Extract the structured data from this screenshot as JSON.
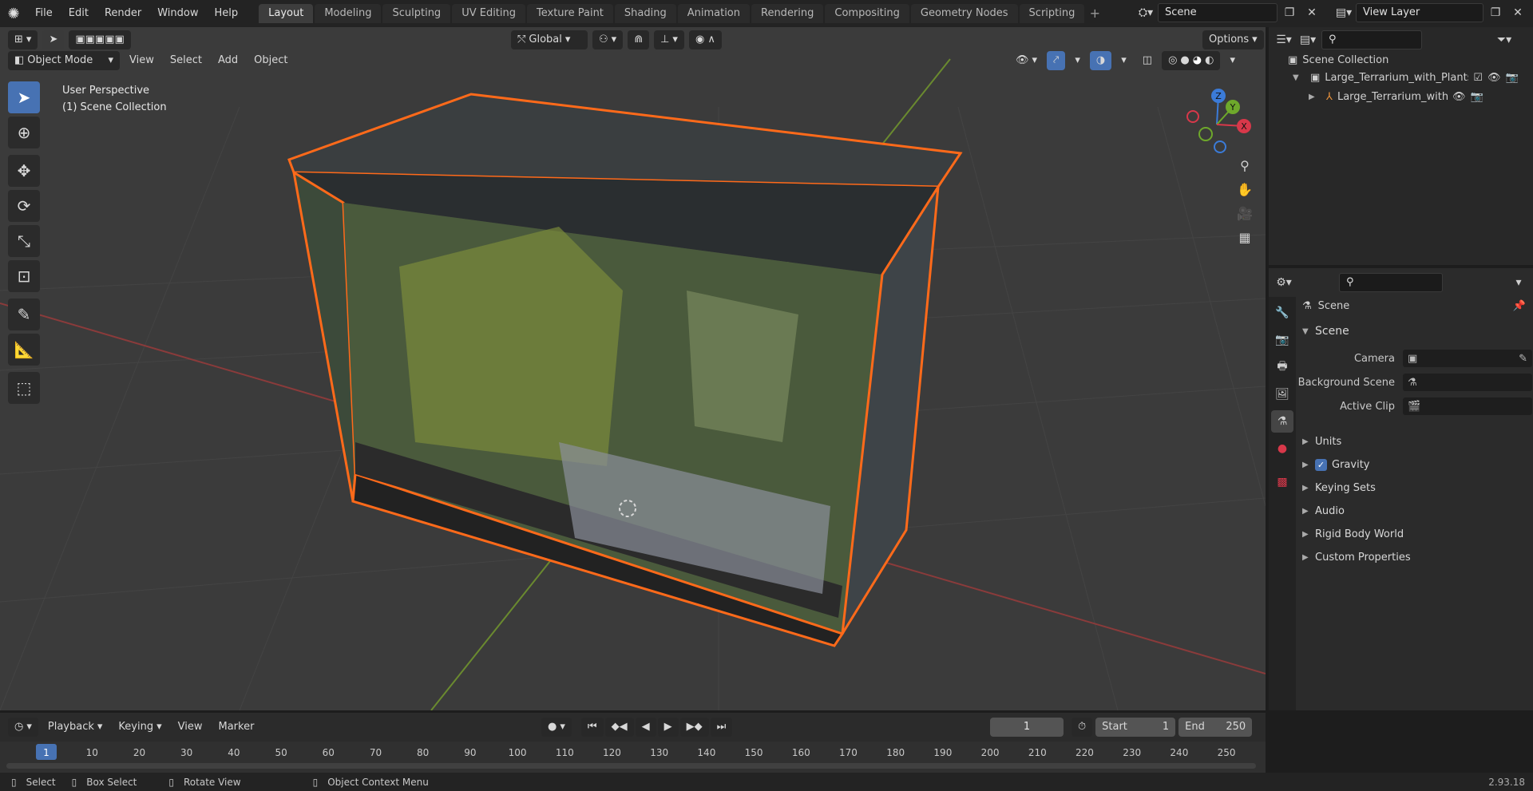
{
  "topbar": {
    "menus": [
      "File",
      "Edit",
      "Render",
      "Window",
      "Help"
    ],
    "workspaces": [
      "Layout",
      "Modeling",
      "Sculpting",
      "UV Editing",
      "Texture Paint",
      "Shading",
      "Animation",
      "Rendering",
      "Compositing",
      "Geometry Nodes",
      "Scripting"
    ],
    "active_workspace": "Layout",
    "scene_name": "Scene",
    "view_layer": "View Layer"
  },
  "viewport": {
    "mode": "Object Mode",
    "menus": [
      "View",
      "Select",
      "Add",
      "Object"
    ],
    "transform_orientation": "Global",
    "options_label": "Options",
    "overlay_title": "User Perspective",
    "overlay_sub": "(1) Scene Collection",
    "gizmo": {
      "x": "X",
      "y": "Y",
      "z": "Z"
    }
  },
  "outliner": {
    "root": "Scene Collection",
    "items": [
      {
        "label": "Large_Terrarium_with_Plants_"
      },
      {
        "label": "Large_Terrarium_with_Pl"
      }
    ]
  },
  "properties": {
    "header": "Scene",
    "panel": "Scene",
    "fields": [
      {
        "label": "Camera",
        "value": ""
      },
      {
        "label": "Background Scene",
        "value": ""
      },
      {
        "label": "Active Clip",
        "value": ""
      }
    ],
    "sections": [
      "Units",
      "Gravity",
      "Keying Sets",
      "Audio",
      "Rigid Body World",
      "Custom Properties"
    ],
    "gravity_checked": true
  },
  "timeline": {
    "menus": [
      "Playback",
      "Keying",
      "View",
      "Marker"
    ],
    "current_frame": "1",
    "start_label": "Start",
    "start": "1",
    "end_label": "End",
    "end": "250",
    "ticks": [
      "1",
      "10",
      "20",
      "30",
      "40",
      "50",
      "60",
      "70",
      "80",
      "90",
      "100",
      "110",
      "120",
      "130",
      "140",
      "150",
      "160",
      "170",
      "180",
      "190",
      "200",
      "210",
      "220",
      "230",
      "240",
      "250"
    ]
  },
  "statusbar": {
    "select": "Select",
    "box_select": "Box Select",
    "rotate": "Rotate View",
    "context": "Object Context Menu",
    "version": "2.93.18"
  },
  "colors": {
    "accent": "#4772b3",
    "selection": "#ff6a1a",
    "bg": "#3b3b3b"
  }
}
